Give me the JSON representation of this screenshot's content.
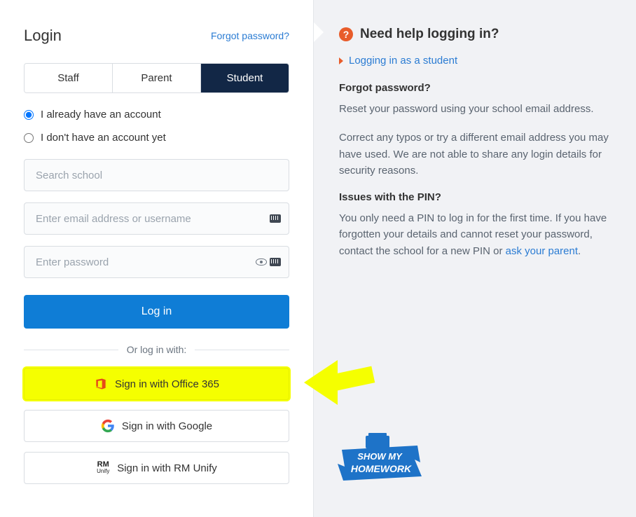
{
  "login": {
    "title": "Login",
    "forgot_link": "Forgot password?",
    "tabs": {
      "staff": "Staff",
      "parent": "Parent",
      "student": "Student"
    },
    "radios": {
      "have": "I already have an account",
      "nohave": "I don't have an account yet"
    },
    "placeholders": {
      "school": "Search school",
      "email": "Enter email address or username",
      "password": "Enter password"
    },
    "login_btn": "Log in",
    "divider": "Or log in with:",
    "sso": {
      "office": "Sign in with Office 365",
      "google": "Sign in with Google",
      "rm": "Sign in with RM Unify"
    }
  },
  "help": {
    "heading": "Need help logging in?",
    "student_link": "Logging in as a student",
    "forgot_title": "Forgot password?",
    "forgot_p1": "Reset your password using your school email address.",
    "forgot_p2": "Correct any typos or try a different email address you may have used. We are not able to share any login details for security reasons.",
    "pin_title": "Issues with the PIN?",
    "pin_text_pre": "You only need a PIN to log in for the first time. If you have forgotten your details and cannot reset your password, contact the school for a new PIN or ",
    "pin_link": "ask your parent",
    "pin_text_post": "."
  }
}
